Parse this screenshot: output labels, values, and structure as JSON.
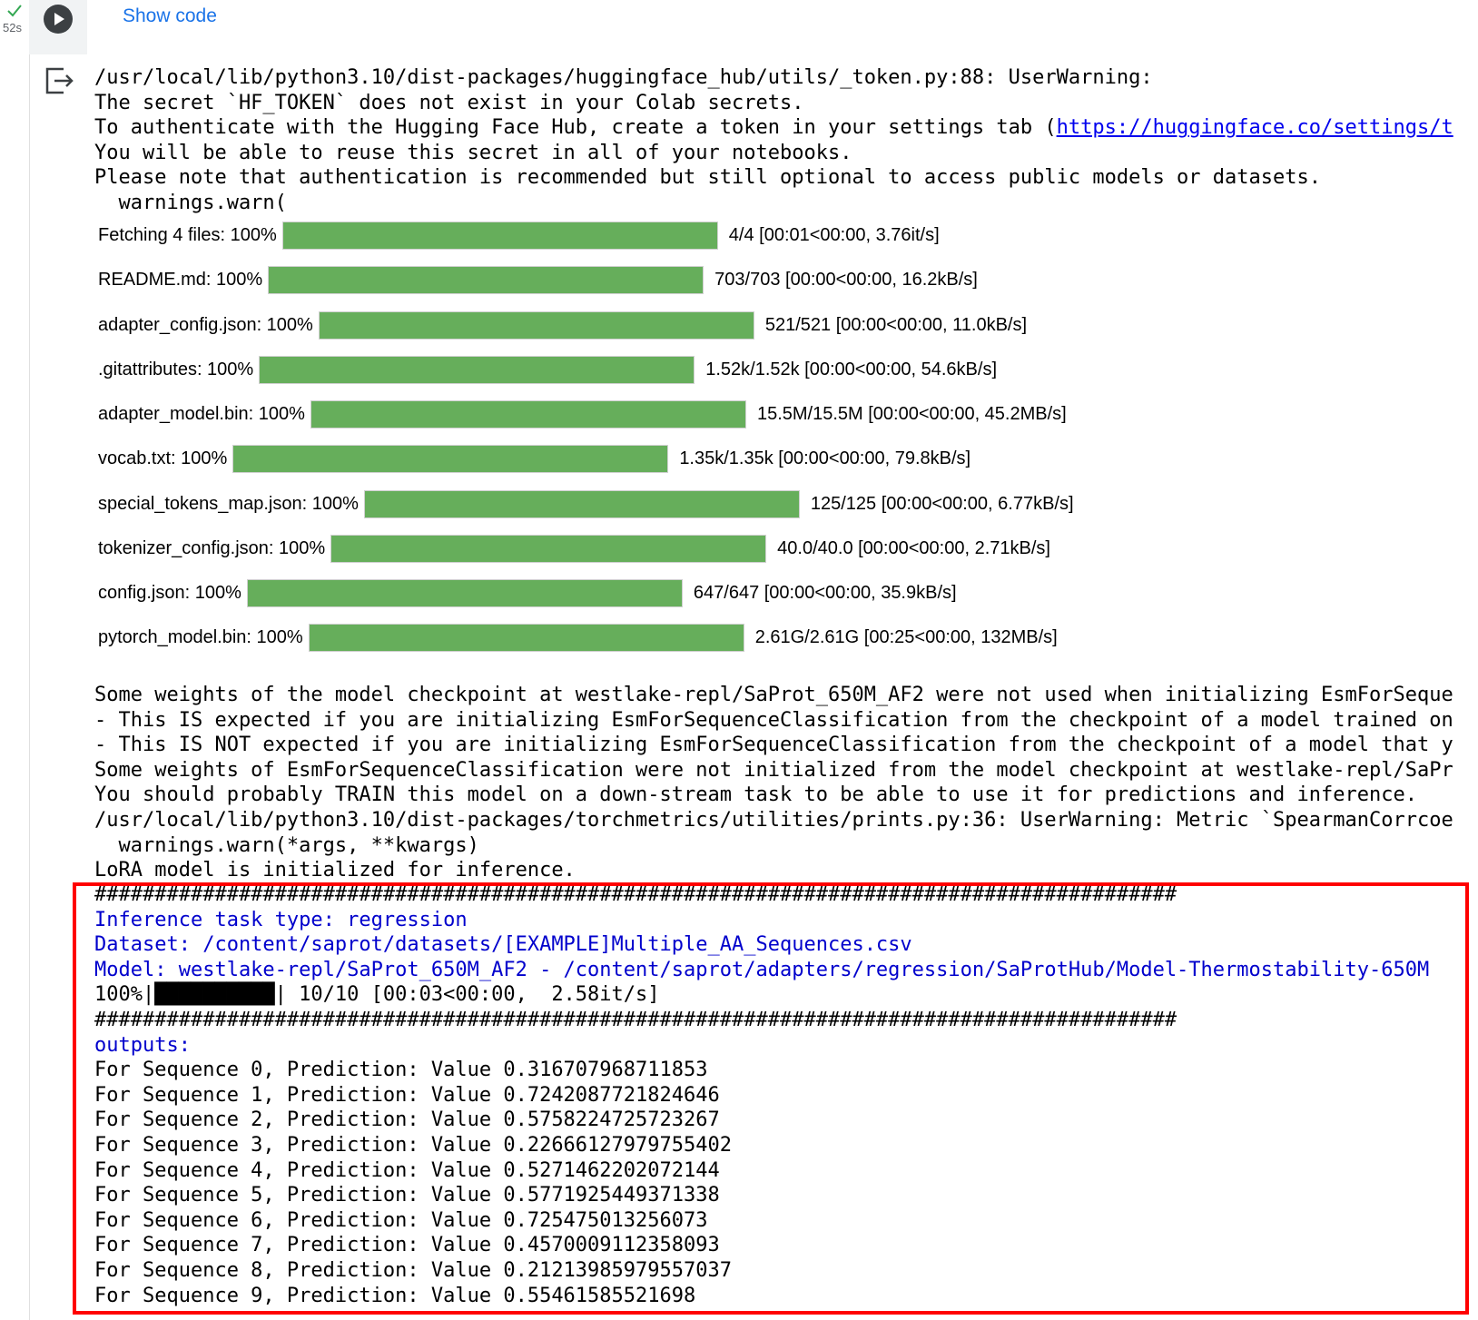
{
  "cell": {
    "status_icon": "check-icon",
    "exec_time": "52s",
    "run_icon": "play-icon",
    "show_code_label": "Show code",
    "output_icon": "output-arrow-icon"
  },
  "console_top": [
    {
      "text": "/usr/local/lib/python3.10/dist-packages/huggingface_hub/utils/_token.py:88: UserWarning:"
    },
    {
      "text": "The secret `HF_TOKEN` does not exist in your Colab secrets."
    },
    {
      "text": "To authenticate with the Hugging Face Hub, create a token in your settings tab (",
      "link": "https://huggingface.co/settings/t"
    },
    {
      "text": "You will be able to reuse this secret in all of your notebooks."
    },
    {
      "text": "Please note that authentication is recommended but still optional to access public models or datasets."
    },
    {
      "text": "  warnings.warn("
    }
  ],
  "progress_bars": [
    {
      "label": "Fetching 4 files: 100%",
      "value": 1.0,
      "stats": "4/4 [00:01<00:00,  3.76it/s]"
    },
    {
      "label": "README.md: 100%",
      "value": 1.0,
      "stats": "703/703 [00:00<00:00, 16.2kB/s]"
    },
    {
      "label": "adapter_config.json: 100%",
      "value": 1.0,
      "stats": "521/521 [00:00<00:00, 11.0kB/s]"
    },
    {
      "label": ".gitattributes: 100%",
      "value": 1.0,
      "stats": "1.52k/1.52k [00:00<00:00, 54.6kB/s]"
    },
    {
      "label": "adapter_model.bin: 100%",
      "value": 1.0,
      "stats": "15.5M/15.5M [00:00<00:00, 45.2MB/s]"
    },
    {
      "label": "vocab.txt: 100%",
      "value": 1.0,
      "stats": "1.35k/1.35k [00:00<00:00, 79.8kB/s]"
    },
    {
      "label": "special_tokens_map.json: 100%",
      "value": 1.0,
      "stats": "125/125 [00:00<00:00, 6.77kB/s]"
    },
    {
      "label": "tokenizer_config.json: 100%",
      "value": 1.0,
      "stats": "40.0/40.0 [00:00<00:00, 2.71kB/s]"
    },
    {
      "label": "config.json: 100%",
      "value": 1.0,
      "stats": "647/647 [00:00<00:00, 35.9kB/s]"
    },
    {
      "label": "pytorch_model.bin: 100%",
      "value": 1.0,
      "stats": "2.61G/2.61G [00:25<00:00, 132MB/s]"
    }
  ],
  "console_bottom": [
    {
      "text": "Some weights of the model checkpoint at westlake-repl/SaProt_650M_AF2 were not used when initializing EsmForSeque"
    },
    {
      "text": "- This IS expected if you are initializing EsmForSequenceClassification from the checkpoint of a model trained on"
    },
    {
      "text": "- This IS NOT expected if you are initializing EsmForSequenceClassification from the checkpoint of a model that y"
    },
    {
      "text": "Some weights of EsmForSequenceClassification were not initialized from the model checkpoint at westlake-repl/SaPr"
    },
    {
      "text": "You should probably TRAIN this model on a down-stream task to be able to use it for predictions and inference."
    },
    {
      "text": "/usr/local/lib/python3.10/dist-packages/torchmetrics/utilities/prints.py:36: UserWarning: Metric `SpearmanCorrcoe"
    },
    {
      "text": "  warnings.warn(*args, **kwargs)"
    },
    {
      "text": "LoRA model is initialized for inference."
    }
  ],
  "console_result": [
    {
      "text": "##########################################################################################",
      "color": "black"
    },
    {
      "text": "Inference task type: regression",
      "color": "blue"
    },
    {
      "text": "Dataset: /content/saprot/datasets/[EXAMPLE]Multiple_AA_Sequences.csv",
      "color": "blue"
    },
    {
      "text": "Model: westlake-repl/SaProt_650M_AF2 - /content/saprot/adapters/regression/SaProtHub/Model-Thermostability-650M",
      "color": "blue"
    },
    {
      "text": "100%|██████████| 10/10 [00:03<00:00,  2.58it/s]",
      "color": "black"
    },
    {
      "text": "##########################################################################################",
      "color": "black"
    },
    {
      "text": "outputs:",
      "color": "blue"
    },
    {
      "text": "For Sequence 0, Prediction: Value 0.316707968711853",
      "color": "black"
    },
    {
      "text": "For Sequence 1, Prediction: Value 0.7242087721824646",
      "color": "black"
    },
    {
      "text": "For Sequence 2, Prediction: Value 0.5758224725723267",
      "color": "black"
    },
    {
      "text": "For Sequence 3, Prediction: Value 0.22666127979755402",
      "color": "black"
    },
    {
      "text": "For Sequence 4, Prediction: Value 0.5271462202072144",
      "color": "black"
    },
    {
      "text": "For Sequence 5, Prediction: Value 0.5771925449371338",
      "color": "black"
    },
    {
      "text": "For Sequence 6, Prediction: Value 0.725475013256073",
      "color": "black"
    },
    {
      "text": "For Sequence 7, Prediction: Value 0.4570009112358093",
      "color": "black"
    },
    {
      "text": "For Sequence 8, Prediction: Value 0.21213985979557037",
      "color": "black"
    },
    {
      "text": "For Sequence 9, Prediction: Value 0.55461585521698",
      "color": "black"
    }
  ],
  "colors": {
    "progress_fill": "#66ae5b",
    "highlight_border": "#ff0000",
    "info_text": "#0000cc",
    "link": "#0000ee",
    "show_code": "#1a73e8"
  }
}
